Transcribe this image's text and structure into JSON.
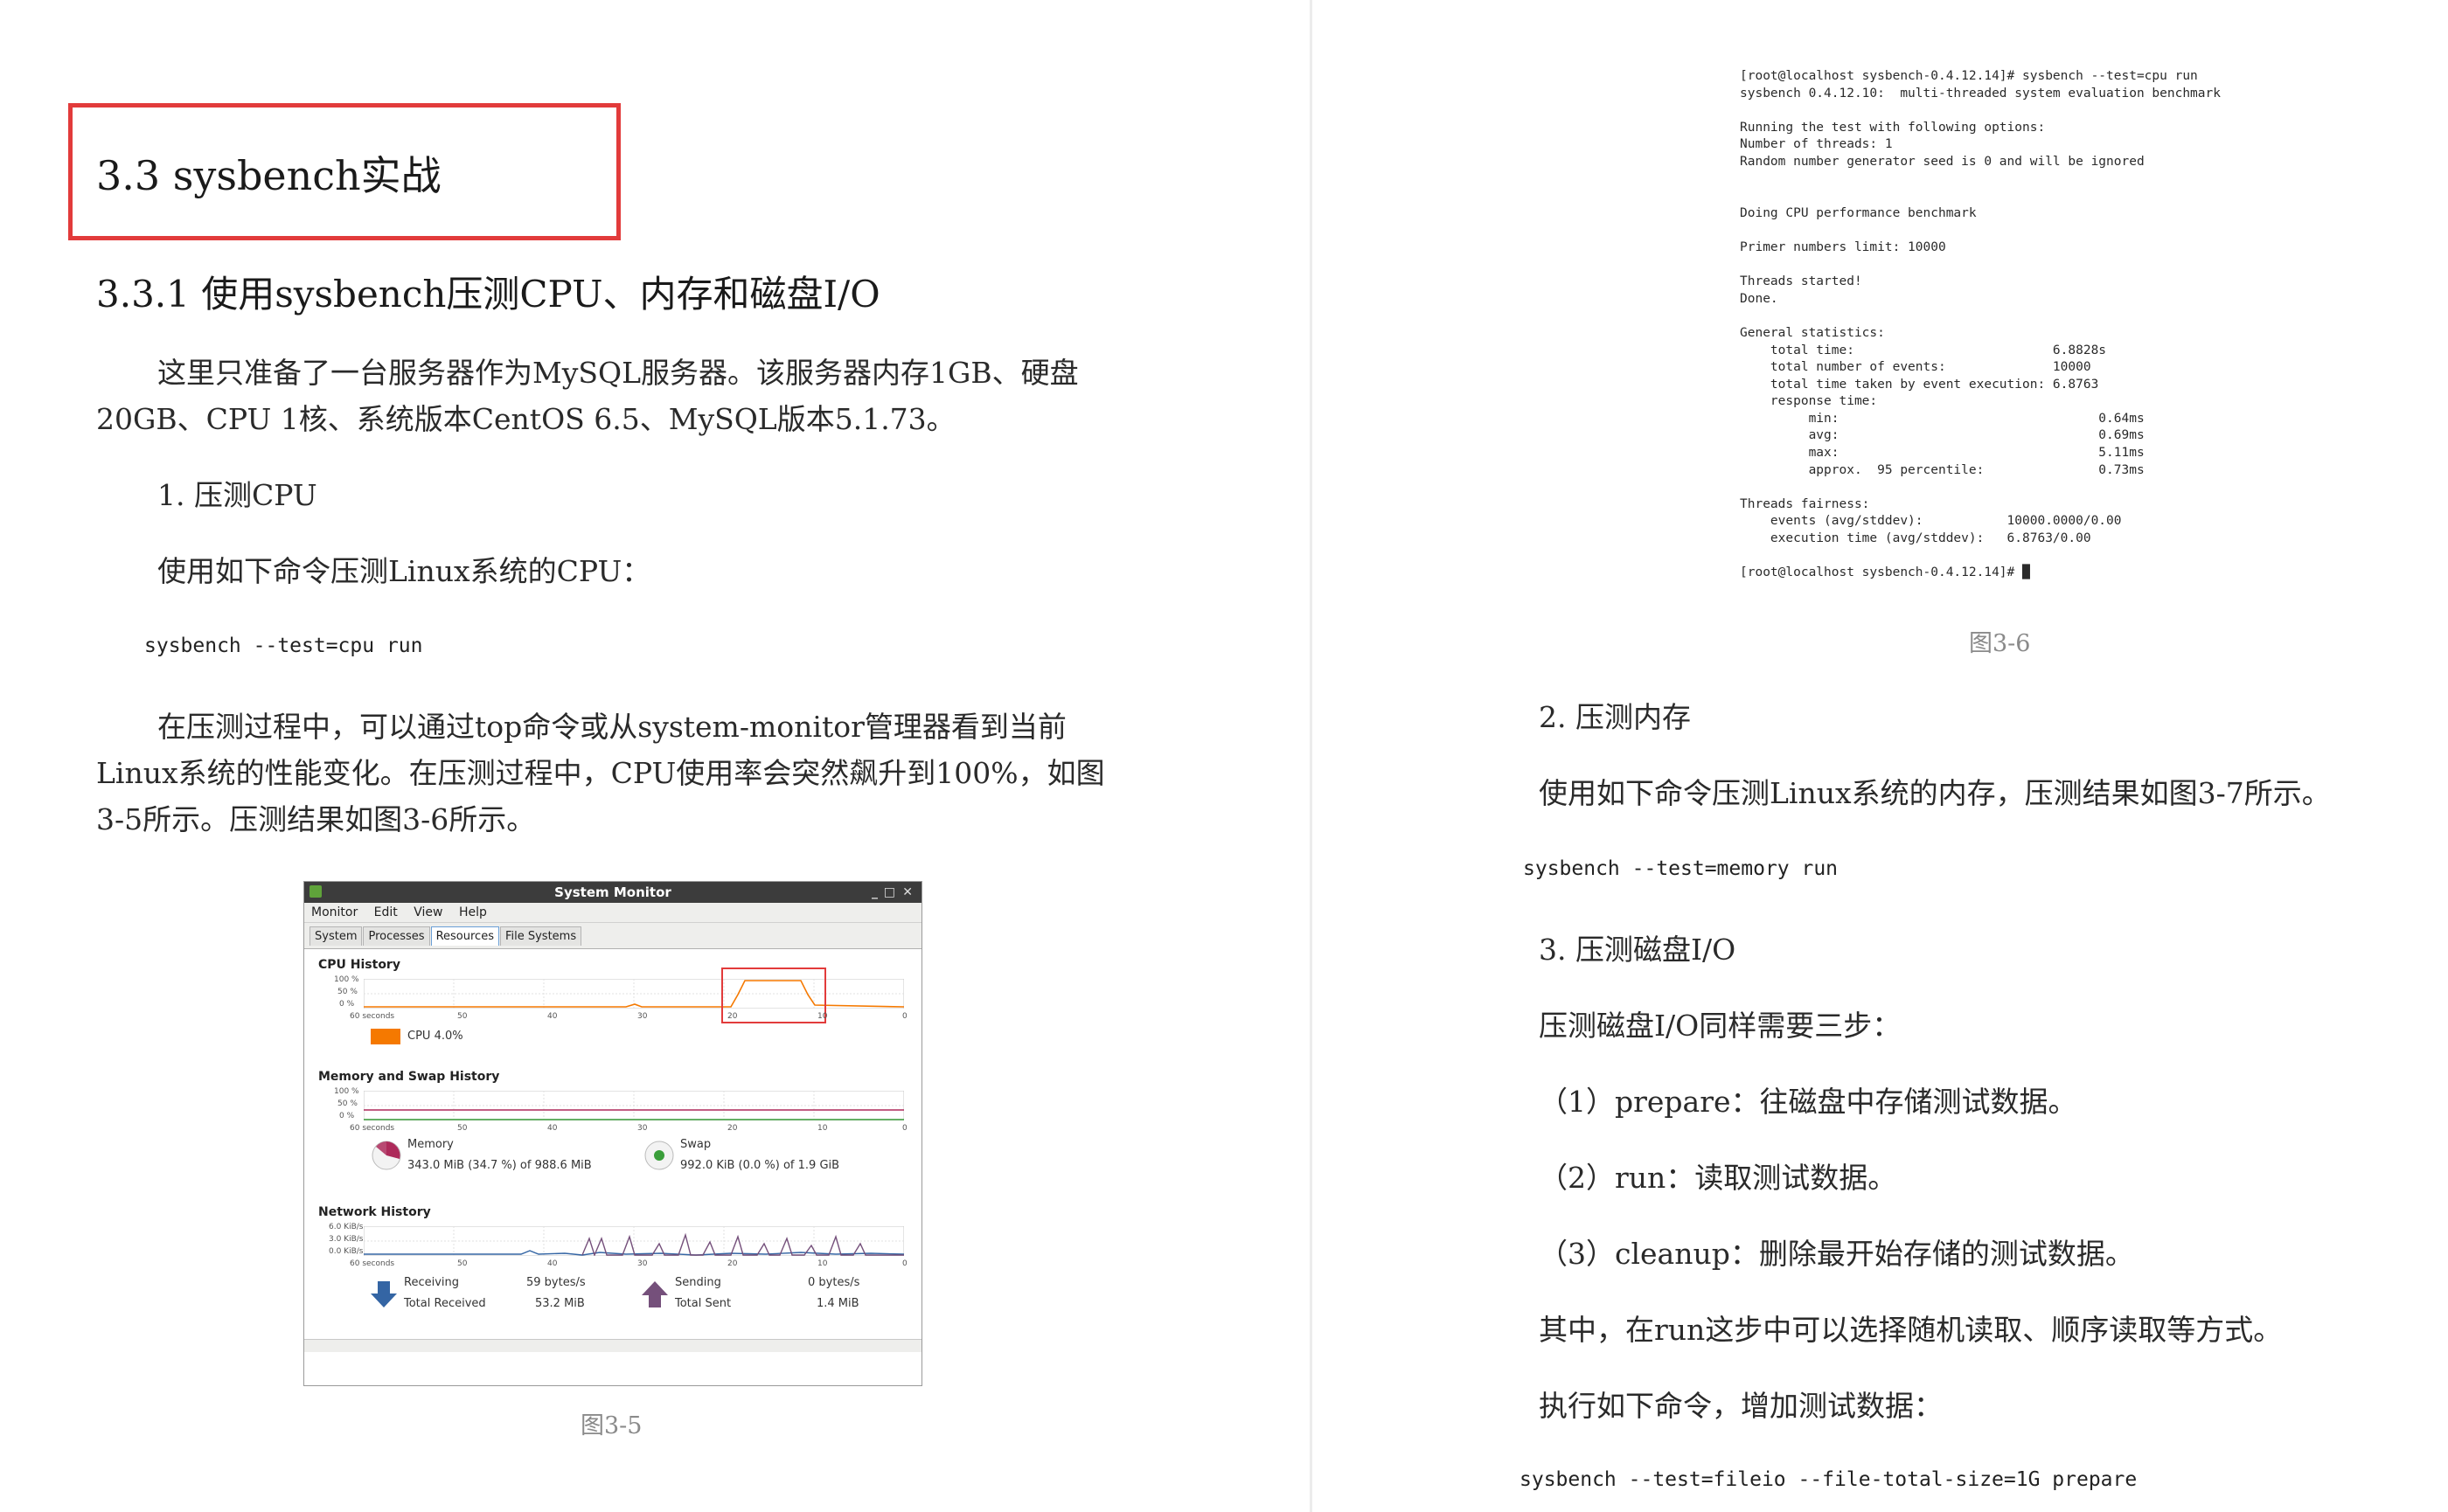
{
  "left": {
    "heading": "3.3  sysbench实战",
    "subheading": "3.3.1  使用sysbench压测CPU、内存和磁盘I/O",
    "intro_line1": "这里只准备了一台服务器作为MySQL服务器。该服务器内存1GB、硬盘",
    "intro_line2": "20GB、CPU 1核、系统版本CentOS 6.5、MySQL版本5.1.73。",
    "item1": "1. 压测CPU",
    "cmd_intro": "使用如下命令压测Linux系统的CPU：",
    "cmd": "sysbench --test=cpu run",
    "p2_line1": "在压测过程中，可以通过top命令或从system-monitor管理器看到当前",
    "p2_line2": "Linux系统的性能变化。在压测过程中，CPU使用率会突然飙升到100%，如图",
    "p2_line3": "3-5所示。压测结果如图3-6所示。",
    "caption": "图3-5"
  },
  "sysmon": {
    "title": "System Monitor",
    "menu": [
      "Monitor",
      "Edit",
      "View",
      "Help"
    ],
    "tabs": [
      "System",
      "Processes",
      "Resources",
      "File Systems"
    ],
    "active_tab": "Resources",
    "cpu_section": "CPU History",
    "cpu_legend": "CPU 4.0%",
    "cpu_y_ticks": [
      "100 %",
      "50 %",
      "0 %"
    ],
    "x_ticks": [
      "60 seconds",
      "50",
      "40",
      "30",
      "20",
      "10",
      "0"
    ],
    "mem_section": "Memory and Swap History",
    "mem_y_ticks": [
      "100 %",
      "50 %",
      "0 %"
    ],
    "memory_label": "Memory",
    "memory_value": "343.0 MiB (34.7 %) of 988.6 MiB",
    "swap_label": "Swap",
    "swap_value": "992.0 KiB (0.0 %) of 1.9 GiB",
    "net_section": "Network History",
    "net_y_ticks": [
      "6.0 KiB/s",
      "3.0 KiB/s",
      "0.0 KiB/s"
    ],
    "receiving_label": "Receiving",
    "receiving_rate": "59 bytes/s",
    "total_received_label": "Total Received",
    "total_received": "53.2 MiB",
    "sending_label": "Sending",
    "sending_rate": "0 bytes/s",
    "total_sent_label": "Total Sent",
    "total_sent": "1.4 MiB",
    "colors": {
      "cpu": "#f57900",
      "memory": "#ad2a5a",
      "swap": "#3a9e3a",
      "receive": "#3465a4",
      "send": "#75507b",
      "highlight": "#e23b3b"
    }
  },
  "terminal": {
    "lines": [
      "[root@localhost sysbench-0.4.12.14]# sysbench --test=cpu run",
      "sysbench 0.4.12.10:  multi-threaded system evaluation benchmark",
      "",
      "Running the test with following options:",
      "Number of threads: 1",
      "Random number generator seed is 0 and will be ignored",
      "",
      "",
      "Doing CPU performance benchmark",
      "",
      "Primer numbers limit: 10000",
      "",
      "Threads started!",
      "Done.",
      "",
      "General statistics:",
      "    total time:                          6.8828s",
      "    total number of events:              10000",
      "    total time taken by event execution: 6.8763",
      "    response time:",
      "         min:                                  0.64ms",
      "         avg:                                  0.69ms",
      "         max:                                  5.11ms",
      "         approx.  95 percentile:               0.73ms",
      "",
      "Threads fairness:",
      "    events (avg/stddev):           10000.0000/0.00",
      "    execution time (avg/stddev):   6.8763/0.00",
      "",
      "[root@localhost sysbench-0.4.12.14]# █"
    ]
  },
  "right": {
    "caption": "图3-6",
    "item2": "2. 压测内存",
    "mem_intro": "使用如下命令压测Linux系统的内存，压测结果如图3-7所示。",
    "mem_cmd": "sysbench  --test=memory run",
    "item3": "3. 压测磁盘I/O",
    "io_intro": "压测磁盘I/O同样需要三步：",
    "step1": "（1）prepare：往磁盘中存储测试数据。",
    "step2": "（2）run：读取测试数据。",
    "step3": "（3）cleanup：删除最开始存储的测试数据。",
    "note": "其中，在run这步中可以选择随机读取、顺序读取等方式。",
    "exec_intro": "执行如下命令，增加测试数据：",
    "io_cmd": "sysbench --test=fileio --file-total-size=1G prepare"
  }
}
